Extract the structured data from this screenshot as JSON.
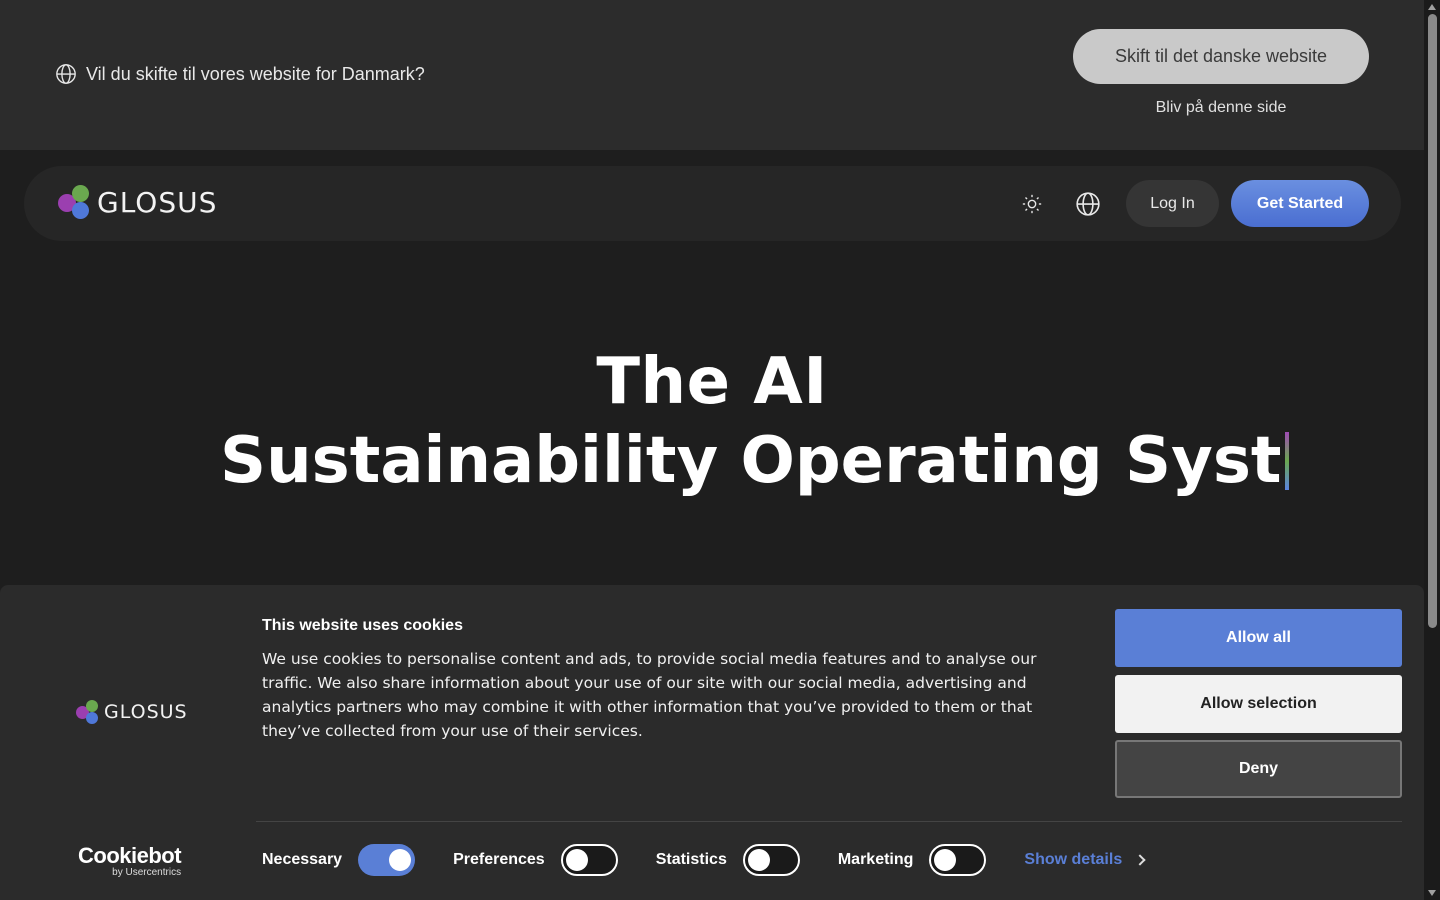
{
  "locale_banner": {
    "message": "Vil du skifte til vores website for Danmark?",
    "switch_label": "Skift til det danske website",
    "stay_label": "Bliv på denne side"
  },
  "nav": {
    "logo_text": "GLOSUS",
    "login_label": "Log In",
    "get_started_label": "Get Started"
  },
  "hero": {
    "line1": "The AI",
    "line2": "Sustainability Operating Syst"
  },
  "cookie": {
    "logo_text": "GLOSUS",
    "title": "This website uses cookies",
    "body": "We use cookies to personalise content and ads, to provide social media features and to analyse our traffic. We also share information about your use of our site with our social media, advertising and analytics partners who may combine it with other information that you’ve provided to them or that they’ve collected from your use of their services.",
    "allow_all": "Allow all",
    "allow_selection": "Allow selection",
    "deny": "Deny",
    "cookiebot_main": "Cookiebot",
    "cookiebot_sub": "by Usercentrics",
    "categories": [
      {
        "label": "Necessary",
        "enabled": true
      },
      {
        "label": "Preferences",
        "enabled": false
      },
      {
        "label": "Statistics",
        "enabled": false
      },
      {
        "label": "Marketing",
        "enabled": false
      }
    ],
    "show_details": "Show details"
  },
  "colors": {
    "accent": "#5a7fd6",
    "logo_purple": "#9b3fb0",
    "logo_green": "#6aa84f",
    "logo_blue": "#4f78d9"
  }
}
